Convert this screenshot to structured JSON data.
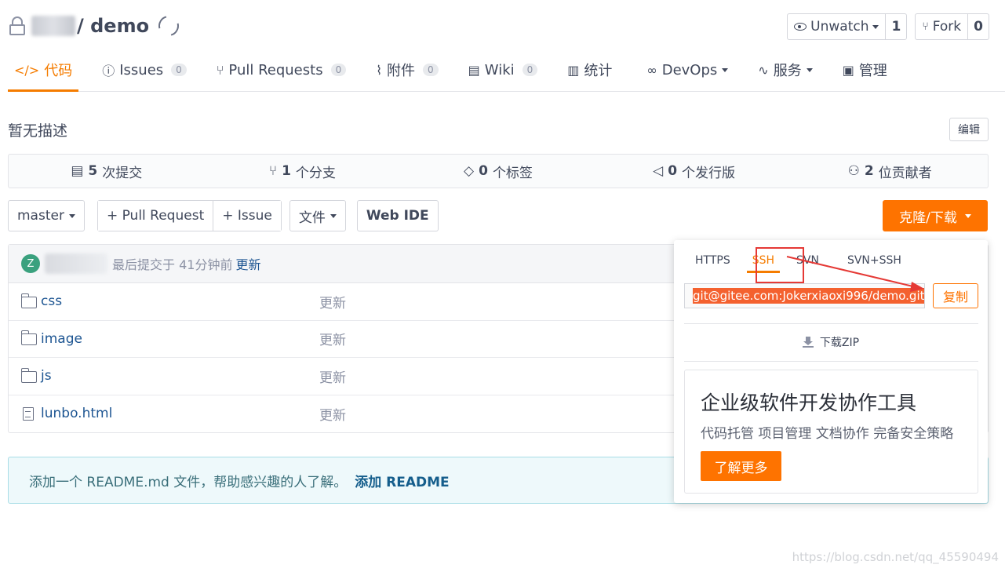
{
  "header": {
    "repo_name": "/ demo",
    "unwatch": {
      "label": "Unwatch",
      "count": "1"
    },
    "fork": {
      "label": "Fork",
      "count": "0"
    }
  },
  "tabs": [
    {
      "label": "代码",
      "icon": "code-icon",
      "badge": ""
    },
    {
      "label": "Issues",
      "icon": "issue-icon",
      "badge": "0"
    },
    {
      "label": "Pull Requests",
      "icon": "pull-request-icon",
      "badge": "0"
    },
    {
      "label": "附件",
      "icon": "attachment-icon",
      "badge": "0"
    },
    {
      "label": "Wiki",
      "icon": "wiki-icon",
      "badge": "0"
    },
    {
      "label": "统计",
      "icon": "stats-icon",
      "badge": ""
    },
    {
      "label": "DevOps",
      "icon": "infinity-icon",
      "badge": ""
    },
    {
      "label": "服务",
      "icon": "pulse-icon",
      "badge": ""
    },
    {
      "label": "管理",
      "icon": "manage-icon",
      "badge": ""
    }
  ],
  "description": {
    "text": "暂无描述",
    "edit_label": "编辑"
  },
  "stats": [
    {
      "num": "5",
      "label": "次提交"
    },
    {
      "num": "1",
      "label": "个分支"
    },
    {
      "num": "0",
      "label": "个标签"
    },
    {
      "num": "0",
      "label": "个发行版"
    },
    {
      "num": "2",
      "label": "位贡献者"
    }
  ],
  "toolbar": {
    "branch": "master",
    "pull_request": "+ Pull Request",
    "issue": "+ Issue",
    "file": "文件",
    "web_ide": "Web IDE",
    "clone": "克隆/下载"
  },
  "commit": {
    "avatar_letter": "Z",
    "text": "最后提交于 41分钟前",
    "link": "更新"
  },
  "files": [
    {
      "name": "css",
      "type": "folder",
      "message": "更新"
    },
    {
      "name": "image",
      "type": "folder",
      "message": "更新"
    },
    {
      "name": "js",
      "type": "folder",
      "message": "更新"
    },
    {
      "name": "lunbo.html",
      "type": "file",
      "message": "更新"
    }
  ],
  "readme": {
    "text": "添加一个 README.md 文件，帮助感兴趣的人了解。",
    "link": "添加 README"
  },
  "clone_dropdown": {
    "tabs": [
      "HTTPS",
      "SSH",
      "SVN",
      "SVN+SSH"
    ],
    "active_tab": "SSH",
    "url": "git@gitee.com:Jokerxiaoxi996/demo.git",
    "copy_label": "复制",
    "zip_label": "下载ZIP",
    "promo_title": "企业级软件开发协作工具",
    "promo_sub": "代码托管 项目管理 文档协作 完备安全策略",
    "promo_button": "了解更多"
  },
  "watermark": "https://blog.csdn.net/qq_45590494",
  "colors": {
    "accent": "#fe7300",
    "link": "#1d5592",
    "annotation": "#e53935"
  }
}
